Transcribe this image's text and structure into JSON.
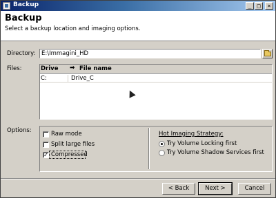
{
  "window": {
    "title": "Backup"
  },
  "titlebar_buttons": {
    "minimize": "_",
    "maximize": "□",
    "close": "×"
  },
  "header": {
    "title": "Backup",
    "subtitle": "Select a backup location and imaging options."
  },
  "directory": {
    "label": "Directory:",
    "value": "E:\\Immagini_HD"
  },
  "files": {
    "label": "Files:",
    "columns": {
      "drive": "Drive",
      "arrow": "➡",
      "name": "File name"
    },
    "rows": [
      {
        "drive": "C:",
        "name": "Drive_C"
      }
    ]
  },
  "options": {
    "label": "Options:",
    "checkboxes": [
      {
        "label": "Raw mode",
        "checked": false
      },
      {
        "label": "Split large files",
        "checked": false
      },
      {
        "label": "Compressed",
        "checked": true,
        "check_mark": "✓"
      }
    ],
    "hot_imaging": {
      "title": "Hot Imaging Strategy:",
      "radios": [
        {
          "label": "Try Volume Locking first",
          "selected": true
        },
        {
          "label": "Try Volume Shadow Services first",
          "selected": false
        }
      ]
    }
  },
  "buttons": {
    "back": "< Back",
    "next": "Next >",
    "cancel": "Cancel"
  }
}
